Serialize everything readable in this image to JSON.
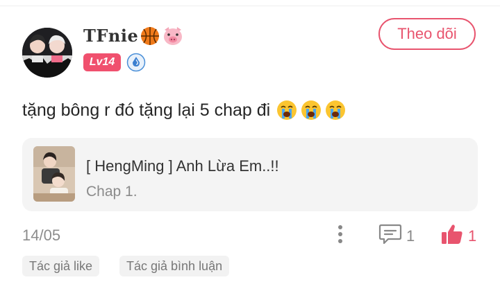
{
  "user": {
    "name": "TFnie",
    "name_emojis": [
      "basketball-emoji",
      "pig-face-emoji"
    ],
    "level": "Lv14",
    "rank_icon": "water-drop-rank-icon"
  },
  "follow_label": "Theo dõi",
  "comment": {
    "text": "tặng bông r đó tặng lại 5 chap đi",
    "emojis": [
      "loudly-crying-face",
      "loudly-crying-face",
      "loudly-crying-face"
    ]
  },
  "reference": {
    "title": "[ HengMing ] Anh Lừa Em..!!",
    "chapter": "Chap 1."
  },
  "meta": {
    "date": "14/05",
    "reply_count": "1",
    "like_count": "1"
  },
  "tags": [
    "Tác giả like",
    "Tác giả bình luận"
  ],
  "colors": {
    "accent": "#e8546e",
    "level_badge": "#f0506e",
    "card_bg": "#f4f4f4",
    "muted_text": "#8c8c8c"
  }
}
